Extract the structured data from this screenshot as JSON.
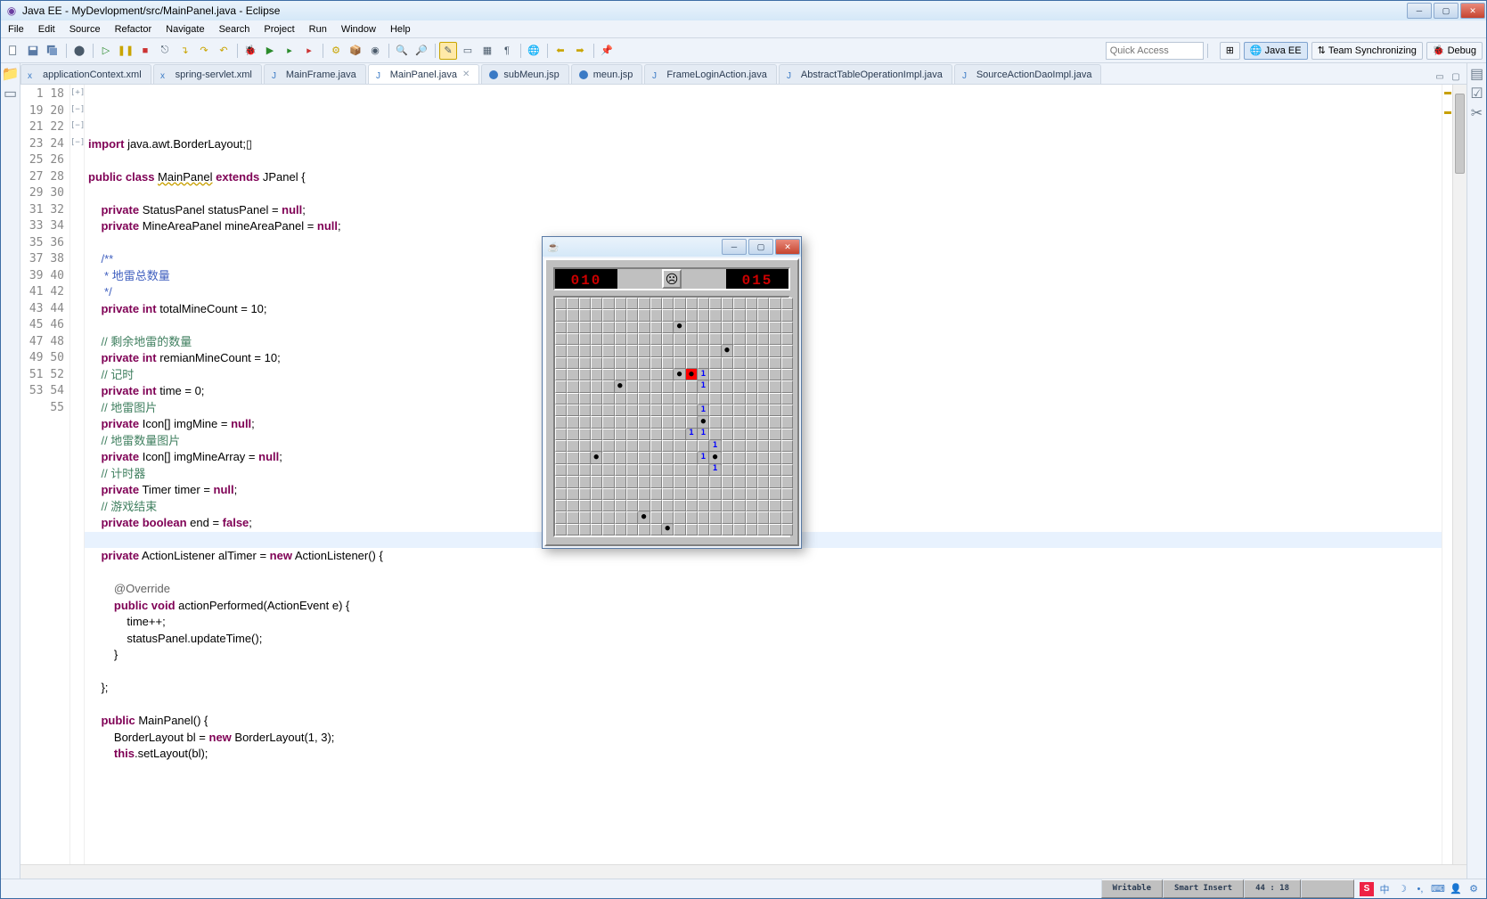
{
  "title": "Java EE - MyDevlopment/src/MainPanel.java - Eclipse",
  "menu": [
    "File",
    "Edit",
    "Source",
    "Refactor",
    "Navigate",
    "Search",
    "Project",
    "Run",
    "Window",
    "Help"
  ],
  "quick_access_placeholder": "Quick Access",
  "perspectives": {
    "java_ee": "Java EE",
    "team": "Team Synchronizing",
    "debug": "Debug"
  },
  "tabs": [
    {
      "label": "applicationContext.xml",
      "icon": "x"
    },
    {
      "label": "spring-servlet.xml",
      "icon": "x"
    },
    {
      "label": "MainFrame.java",
      "icon": "j"
    },
    {
      "label": "MainPanel.java",
      "icon": "j",
      "active": true,
      "closeable": true
    },
    {
      "label": "subMeun.jsp",
      "icon": "jsp"
    },
    {
      "label": "meun.jsp",
      "icon": "jsp"
    },
    {
      "label": "FrameLoginAction.java",
      "icon": "j"
    },
    {
      "label": "AbstractTableOperationImpl.java",
      "icon": "j"
    },
    {
      "label": "SourceActionDaoImpl.java",
      "icon": "j"
    }
  ],
  "code": {
    "first_line": 1,
    "lines": [
      {
        "n": 1,
        "fold": "+",
        "html": "<span class='kw'>import</span> java.awt.BorderLayout;▯"
      },
      {
        "n": 18,
        "html": ""
      },
      {
        "n": 19,
        "html": "<span class='kw'>public class</span> <span class='cls-underline'>MainPanel</span> <span class='kw'>extends</span> JPanel {"
      },
      {
        "n": 20,
        "html": ""
      },
      {
        "n": 21,
        "html": "    <span class='kw'>private</span> StatusPanel statusPanel = <span class='kw'>null</span>;"
      },
      {
        "n": 22,
        "html": "    <span class='kw'>private</span> MineAreaPanel mineAreaPanel = <span class='kw'>null</span>;"
      },
      {
        "n": 23,
        "html": ""
      },
      {
        "n": 24,
        "fold": "-",
        "html": "    <span class='jd'>/**</span>"
      },
      {
        "n": 25,
        "html": "<span class='jd'>     * 地雷总数量</span>"
      },
      {
        "n": 26,
        "html": "<span class='jd'>     */</span>"
      },
      {
        "n": 27,
        "html": "    <span class='kw'>private int</span> totalMineCount = 10;"
      },
      {
        "n": 28,
        "html": ""
      },
      {
        "n": 29,
        "html": "    <span class='cm'>// 剩余地雷的数量</span>"
      },
      {
        "n": 30,
        "html": "    <span class='kw'>private int</span> remianMineCount = 10;"
      },
      {
        "n": 31,
        "html": "    <span class='cm'>// 记时</span>"
      },
      {
        "n": 32,
        "html": "    <span class='kw'>private int</span> time = 0;"
      },
      {
        "n": 33,
        "html": "    <span class='cm'>// 地雷图片</span>"
      },
      {
        "n": 34,
        "html": "    <span class='kw'>private</span> Icon[] imgMine = <span class='kw'>null</span>;"
      },
      {
        "n": 35,
        "html": "    <span class='cm'>// 地雷数量图片</span>"
      },
      {
        "n": 36,
        "html": "    <span class='kw'>private</span> Icon[] imgMineArray = <span class='kw'>null</span>;"
      },
      {
        "n": 37,
        "html": "    <span class='cm'>// 计时器</span>"
      },
      {
        "n": 38,
        "html": "    <span class='kw'>private</span> Timer timer = <span class='kw'>null</span>;"
      },
      {
        "n": 39,
        "html": "    <span class='cm'>// 游戏结束</span>"
      },
      {
        "n": 40,
        "html": "    <span class='kw'>private boolean</span> end = <span class='kw'>false</span>;"
      },
      {
        "n": 41,
        "html": ""
      },
      {
        "n": 42,
        "html": "    <span class='kw'>private</span> ActionListener alTimer = <span class='kw'>new</span> ActionListener() {"
      },
      {
        "n": 43,
        "html": ""
      },
      {
        "n": 44,
        "fold": "-",
        "hl": true,
        "html": "        <span class='an'>@Override</span>"
      },
      {
        "n": 45,
        "html": "        <span class='kw'>public void</span> actionPerformed(ActionEvent e) {"
      },
      {
        "n": 46,
        "html": "            time++;"
      },
      {
        "n": 47,
        "html": "            statusPanel.updateTime();"
      },
      {
        "n": 48,
        "html": "        }"
      },
      {
        "n": 49,
        "html": ""
      },
      {
        "n": 50,
        "html": "    };"
      },
      {
        "n": 51,
        "html": ""
      },
      {
        "n": 52,
        "fold": "-",
        "html": "    <span class='kw'>public</span> MainPanel() {"
      },
      {
        "n": 53,
        "html": "        BorderLayout bl = <span class='kw'>new</span> BorderLayout(1, 3);"
      },
      {
        "n": 54,
        "html": "        <span class='kw'>this</span>.setLayout(bl);"
      },
      {
        "n": 55,
        "html": ""
      }
    ]
  },
  "status": {
    "writable": "Writable",
    "insert": "Smart Insert",
    "pos": "44 : 18"
  },
  "minesweeper": {
    "mine_count": "010",
    "timer": "015",
    "rows": 20,
    "cols": 20,
    "cells": {
      "2,10": {
        "t": "mine"
      },
      "4,14": {
        "t": "mine"
      },
      "6,10": {
        "t": "mine"
      },
      "6,11": {
        "t": "boom"
      },
      "6,12": {
        "t": "1"
      },
      "7,5": {
        "t": "mine"
      },
      "7,12": {
        "t": "1"
      },
      "9,12": {
        "t": "1"
      },
      "10,12": {
        "t": "mine"
      },
      "11,11": {
        "t": "1"
      },
      "11,12": {
        "t": "1"
      },
      "12,13": {
        "t": "1"
      },
      "13,3": {
        "t": "mine"
      },
      "13,12": {
        "t": "1"
      },
      "13,13": {
        "t": "mine"
      },
      "14,13": {
        "t": "1"
      },
      "18,7": {
        "t": "mine"
      },
      "19,9": {
        "t": "mine"
      }
    }
  }
}
